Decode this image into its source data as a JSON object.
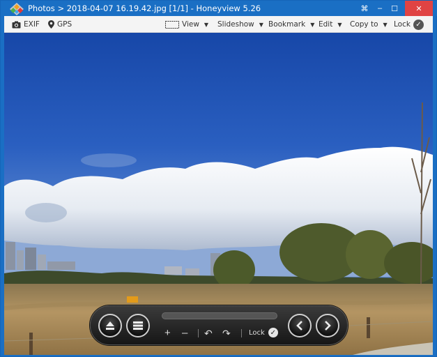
{
  "window": {
    "title": "Photos > 2018-04-07 16.19.42.jpg [1/1] - Honeyview 5.26",
    "controls": {
      "pin": "⌘",
      "minimize": "–",
      "maximize": "☐",
      "close": "✕"
    }
  },
  "toolbar": {
    "exif_label": "EXIF",
    "gps_label": "GPS",
    "view_label": "View",
    "slideshow_label": "Slideshow",
    "bookmark_label": "Bookmark",
    "edit_label": "Edit",
    "copyto_label": "Copy to",
    "lock_label": "Lock"
  },
  "overlay": {
    "zoom_in": "+",
    "zoom_out": "–",
    "rotate_left": "↶",
    "rotate_right": "↷",
    "lock_label": "Lock"
  },
  "colors": {
    "titlebar": "#1a6fc4",
    "close": "#e04343",
    "toolbar": "#f4f4f4"
  }
}
